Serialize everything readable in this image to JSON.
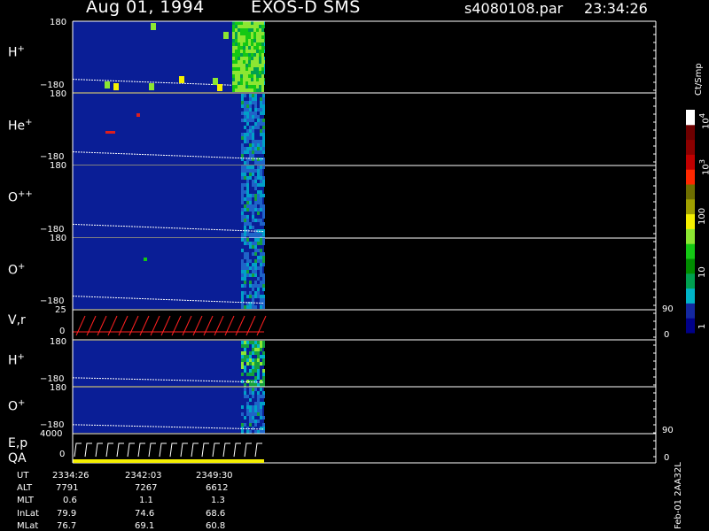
{
  "header": {
    "date": "Aug 01, 1994",
    "instrument": "EXOS-D SMS",
    "file": "s4080108.par",
    "time": "23:34:26"
  },
  "colorbar": {
    "unit": "Ct/Smp",
    "labels": [
      "1",
      "10",
      "100",
      "10",
      "10"
    ],
    "exponents": [
      "",
      "",
      "",
      "3",
      "4"
    ],
    "colors": [
      "#000088",
      "#1428a0",
      "#00b4c8",
      "#00a050",
      "#008c00",
      "#14c814",
      "#8ce632",
      "#f5f000",
      "#a0a000",
      "#6e6e00",
      "#ff2800",
      "#c00000",
      "#8c0000",
      "#6e0000",
      "#ffffff"
    ]
  },
  "panels": [
    {
      "id": "h1",
      "label": "H",
      "sup": "+",
      "ymax": "180",
      "ymin": "−180"
    },
    {
      "id": "he",
      "label": "He",
      "sup": "+",
      "ymax": "180",
      "ymin": "−180"
    },
    {
      "id": "opp",
      "label": "O",
      "sup": "++",
      "ymax": "180",
      "ymin": "−180"
    },
    {
      "id": "op",
      "label": "O",
      "sup": "+",
      "ymax": "180",
      "ymin": "−180"
    },
    {
      "id": "vr",
      "label": "V,r",
      "sup": "",
      "ymax": "25",
      "ymin": "0",
      "rmax": "90",
      "rmin": "0"
    },
    {
      "id": "h2",
      "label": "H",
      "sup": "+",
      "ymax": "180",
      "ymin": "−180"
    },
    {
      "id": "o2",
      "label": "O",
      "sup": "+",
      "ymax": "180",
      "ymin": "−180"
    },
    {
      "id": "ep",
      "label": "E,p",
      "label2": "QA",
      "sup": "",
      "ymax": "4000",
      "ymin": "0",
      "rmax": "90",
      "rmin": "0"
    }
  ],
  "footer": {
    "rows": [
      {
        "name": "UT",
        "values": [
          "2334:26",
          "2342:03",
          "2349:30"
        ]
      },
      {
        "name": "ALT",
        "values": [
          "7791",
          "7267",
          "6612"
        ]
      },
      {
        "name": "MLT",
        "values": [
          "0.6",
          "1.1",
          "1.3"
        ]
      },
      {
        "name": "InLat",
        "values": [
          "79.9",
          "74.6",
          "68.6"
        ]
      },
      {
        "name": "MLat",
        "values": [
          "76.7",
          "69.1",
          "60.8"
        ]
      }
    ],
    "stamp": "Feb-01 2AA32L"
  },
  "chart_data": {
    "type": "heatmap",
    "title": "Aug 01, 1994   EXOS-D SMS",
    "series": [
      {
        "name": "H+",
        "yrange": [
          -180,
          180
        ]
      },
      {
        "name": "He+",
        "yrange": [
          -180,
          180
        ]
      },
      {
        "name": "O++",
        "yrange": [
          -180,
          180
        ]
      },
      {
        "name": "O+",
        "yrange": [
          -180,
          180
        ]
      },
      {
        "name": "V,r",
        "yrange": [
          0,
          25
        ],
        "y2range": [
          0,
          90
        ]
      },
      {
        "name": "H+",
        "yrange": [
          -180,
          180
        ]
      },
      {
        "name": "O+",
        "yrange": [
          -180,
          180
        ]
      },
      {
        "name": "E,p",
        "yrange": [
          0,
          4000
        ],
        "y2range": [
          0,
          90
        ]
      }
    ],
    "x": [
      "2334:26",
      "2342:03",
      "2349:30"
    ],
    "colorscale_ticks": [
      "1",
      "10",
      "100",
      "10^3",
      "10^4"
    ]
  }
}
